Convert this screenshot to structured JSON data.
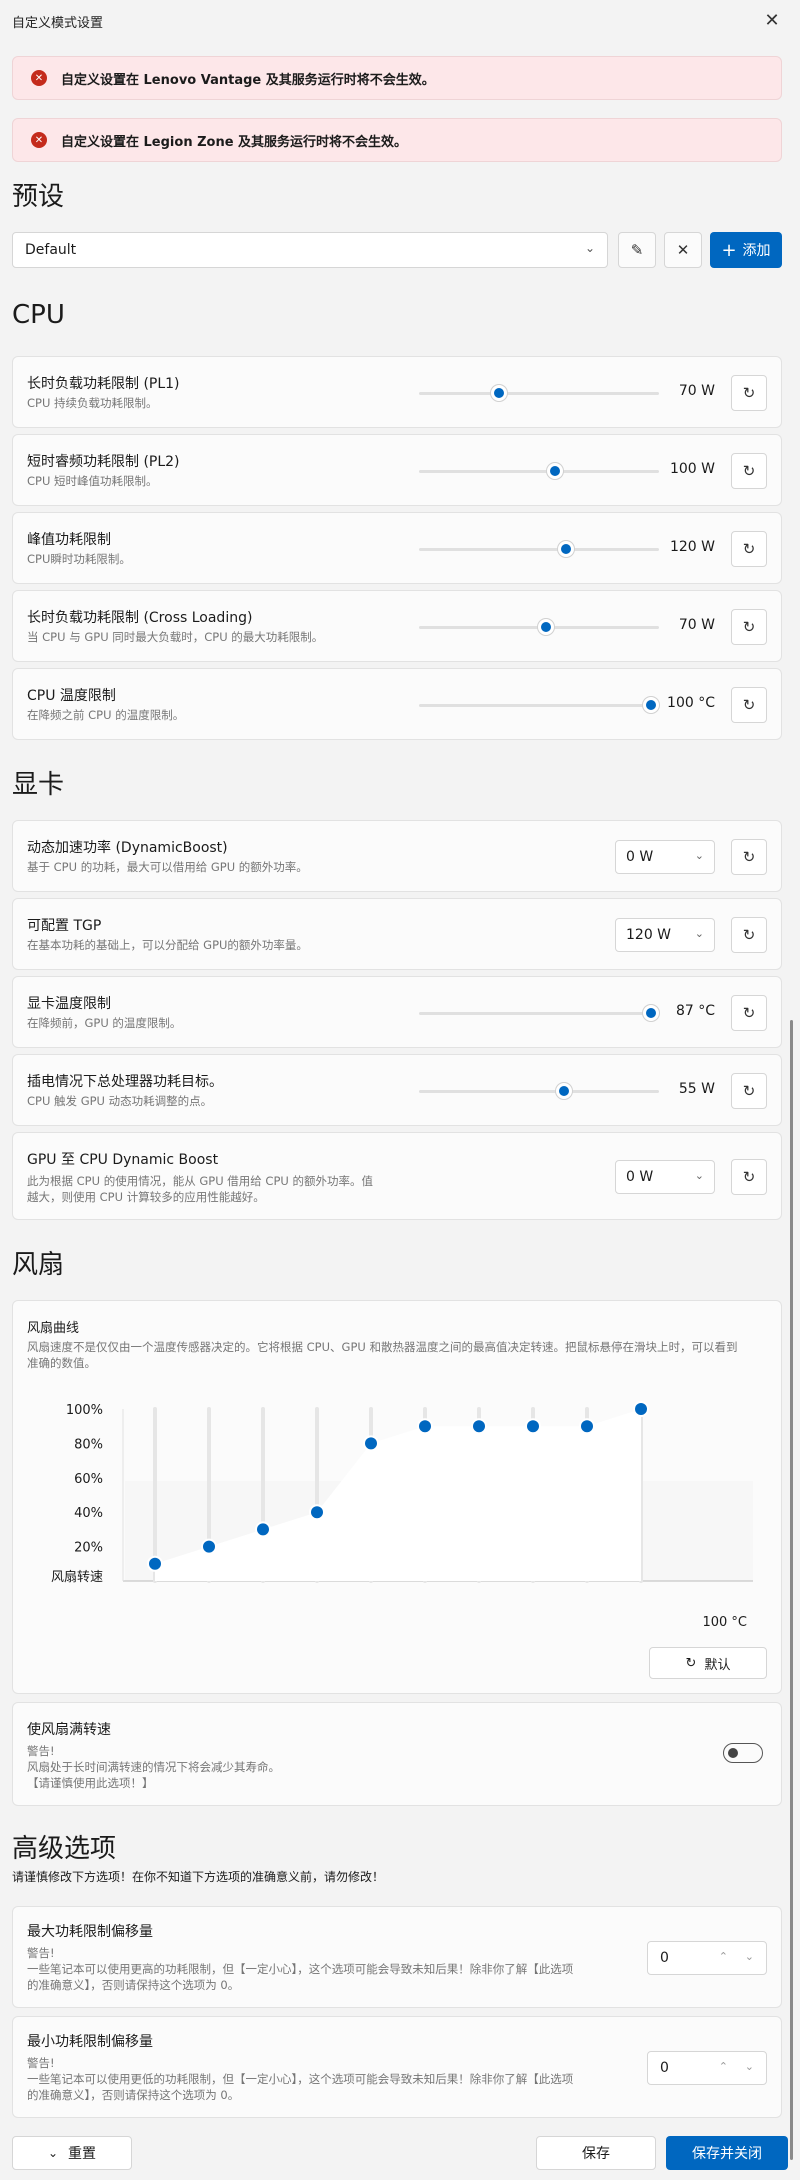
{
  "window": {
    "title": "自定义模式设置"
  },
  "alerts": [
    "自定义设置在 Lenovo Vantage 及其服务运行时将不会生效。",
    "自定义设置在 Legion Zone 及其服务运行时将不会生效。"
  ],
  "preset": {
    "heading": "预设",
    "selected": "Default",
    "add_label": "添加"
  },
  "cpu": {
    "heading": "CPU",
    "items": [
      {
        "title": "长时负载功耗限制 (PL1)",
        "desc": "CPU 持续负载功耗限制。",
        "value": "70 W",
        "level": 0.32
      },
      {
        "title": "短时睿频功耗限制 (PL2)",
        "desc": "CPU 短时峰值功耗限制。",
        "value": "100 W",
        "level": 0.57
      },
      {
        "title": "峰值功耗限制",
        "desc": "CPU瞬时功耗限制。",
        "value": "120 W",
        "level": 0.62
      },
      {
        "title": "长时负载功耗限制 (Cross Loading)",
        "desc": "当 CPU 与 GPU 同时最大负载时，CPU 的最大功耗限制。",
        "value": "70 W",
        "level": 0.53
      },
      {
        "title": "CPU 温度限制",
        "desc": "在降频之前 CPU 的温度限制。",
        "value": "100 °C",
        "level": 1.0
      }
    ]
  },
  "gpu": {
    "heading": "显卡",
    "dynamic_boost": {
      "title": "动态加速功率 (DynamicBoost)",
      "desc": "基于 CPU 的功耗，最大可以借用给 GPU 的额外功率。",
      "value": "0 W"
    },
    "tgp": {
      "title": "可配置 TGP",
      "desc": "在基本功耗的基础上，可以分配给 GPU的额外功率量。",
      "value": "120 W"
    },
    "temp": {
      "title": "显卡温度限制",
      "desc": "在降频前，GPU 的温度限制。",
      "value": "87 °C",
      "level": 1.0
    },
    "total_power": {
      "title": "插电情况下总处理器功耗目标。",
      "desc": "CPU 触发 GPU 动态功耗调整的点。",
      "value": "55 W",
      "level": 0.61
    },
    "gpu_to_cpu": {
      "title": "GPU 至 CPU Dynamic Boost",
      "desc1": "此为根据 CPU 的使用情况，能从 GPU 借用给 CPU 的额外功率。值",
      "desc2": "越大，则使用 CPU 计算较多的应用性能越好。",
      "value": "0 W"
    }
  },
  "fan": {
    "heading": "风扇",
    "curve_title": "风扇曲线",
    "curve_desc1": "风扇速度不是仅仅由一个温度传感器决定的。它将根据 CPU、GPU 和散热器温度之间的最高值决定转速。把鼠标悬停在滑块上时，可以看到",
    "curve_desc2": "准确的数值。",
    "y_ticks": [
      "100%",
      "80%",
      "60%",
      "40%",
      "20%"
    ],
    "y_label": "风扇转速",
    "x_label": "100 °C",
    "default_label": "默认",
    "full_speed": {
      "title": "使风扇满转速",
      "warn1": "警告!",
      "warn2": "风扇处于长时间满转速的情况下将会减少其寿命。",
      "warn3": "【请谨慎使用此选项！】",
      "enabled": false
    }
  },
  "chart_data": {
    "type": "line",
    "title": "风扇曲线",
    "ylabel": "风扇转速",
    "xlabel": "100 °C",
    "ylim": [
      0,
      100
    ],
    "y_ticks": [
      "100%",
      "80%",
      "60%",
      "40%",
      "20%"
    ],
    "series": [
      {
        "values": [
          10,
          20,
          30,
          40,
          80,
          90,
          90,
          90,
          90,
          100
        ]
      }
    ]
  },
  "advanced": {
    "heading": "高级选项",
    "note": "请谨慎修改下方选项！在你不知道下方选项的准确意义前，请勿修改！",
    "max_offset": {
      "title": "最大功耗限制偏移量",
      "warn1": "警告!",
      "warn2": "一些笔记本可以使用更高的功耗限制，但【一定小心】，这个选项可能会导致未知后果！除非你了解【此选项",
      "warn3": "的准确意义】，否则请保持这个选项为 0。",
      "value": "0"
    },
    "min_offset": {
      "title": "最小功耗限制偏移量",
      "warn1": "警告!",
      "warn2": "一些笔记本可以使用更低的功耗限制，但【一定小心】，这个选项可能会导致未知后果！除非你了解【此选项",
      "warn3": "的准确意义】，否则请保持这个选项为 0。",
      "value": "0"
    }
  },
  "footer": {
    "reset_label": "重置",
    "save_label": "保存",
    "save_close_label": "保存并关闭"
  },
  "colors": {
    "accent": "#0067c0",
    "alert_bg": "#fde7e9",
    "alert_icon": "#c42b1c"
  }
}
